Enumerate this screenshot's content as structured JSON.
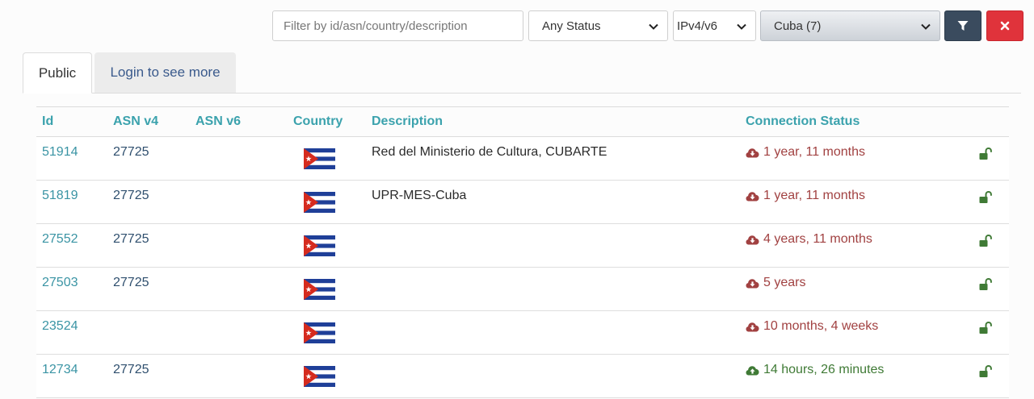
{
  "filters": {
    "search_placeholder": "Filter by id/asn/country/description",
    "status_value": "Any Status",
    "ip_value": "IPv4/v6",
    "country_value": "Cuba (7)"
  },
  "tabs": [
    {
      "label": "Public"
    },
    {
      "label": "Login to see more"
    }
  ],
  "table": {
    "headers": {
      "id": "Id",
      "asn_v4": "ASN v4",
      "asn_v6": "ASN v6",
      "country": "Country",
      "description": "Description",
      "status": "Connection Status"
    },
    "rows": [
      {
        "id": "51914",
        "asn_v4": "27725",
        "asn_v6": "",
        "description": "Red del Ministerio de Cultura, CUBARTE",
        "status": "1 year, 11 months",
        "state": "down"
      },
      {
        "id": "51819",
        "asn_v4": "27725",
        "asn_v6": "",
        "description": "UPR-MES-Cuba",
        "status": "1 year, 11 months",
        "state": "down"
      },
      {
        "id": "27552",
        "asn_v4": "27725",
        "asn_v6": "",
        "description": "",
        "status": "4 years, 11 months",
        "state": "down"
      },
      {
        "id": "27503",
        "asn_v4": "27725",
        "asn_v6": "",
        "description": "",
        "status": "5 years",
        "state": "down"
      },
      {
        "id": "23524",
        "asn_v4": "",
        "asn_v6": "",
        "description": "",
        "status": "10 months, 4 weeks",
        "state": "down"
      },
      {
        "id": "12734",
        "asn_v4": "27725",
        "asn_v6": "",
        "description": "",
        "status": "14 hours, 26 minutes",
        "state": "up"
      }
    ]
  },
  "colors": {
    "down": "#a14141",
    "up": "#3f7a35",
    "lock": "#3f7a35",
    "header": "#3ba2ad"
  },
  "icons": {
    "filter_button": "filter-funnel-icon",
    "clear_button": "close-x-icon",
    "status_down": "cloud-download-icon",
    "status_up": "cloud-upload-icon",
    "lock": "unlock-icon",
    "country_flag": "cuba-flag-icon"
  }
}
